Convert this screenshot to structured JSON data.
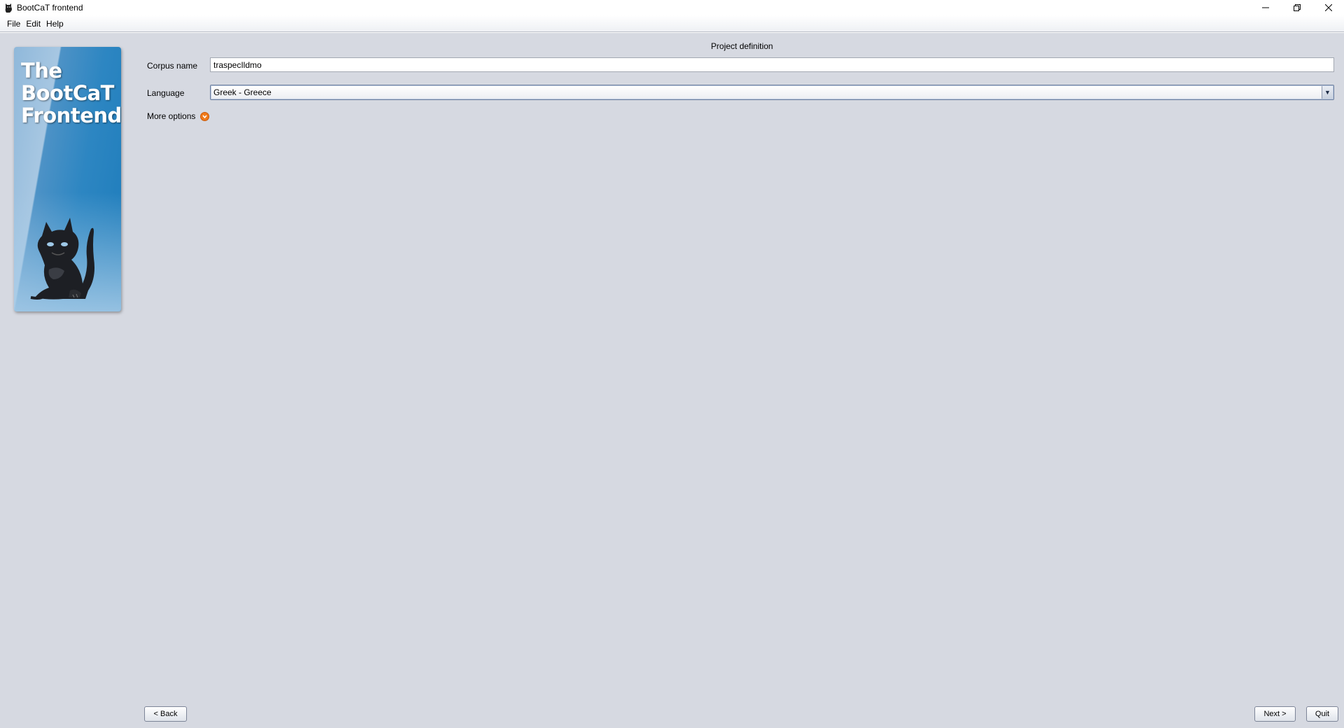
{
  "window": {
    "title": "BootCaT frontend"
  },
  "menu": {
    "items": [
      "File",
      "Edit",
      "Help"
    ]
  },
  "banner": {
    "lines": [
      "The",
      "BootCaT",
      "Frontend"
    ]
  },
  "page": {
    "section_title": "Project definition",
    "corpus_name_label": "Corpus name",
    "corpus_name_value": "traspecIldmo",
    "language_label": "Language",
    "language_value": "Greek - Greece",
    "more_options_label": "More options"
  },
  "buttons": {
    "back": "< Back",
    "next": "Next >",
    "quit": "Quit"
  },
  "colors": {
    "background": "#d6d9e1",
    "accent_orange": "#f07a1a",
    "banner_blue": "#2d86c2"
  }
}
